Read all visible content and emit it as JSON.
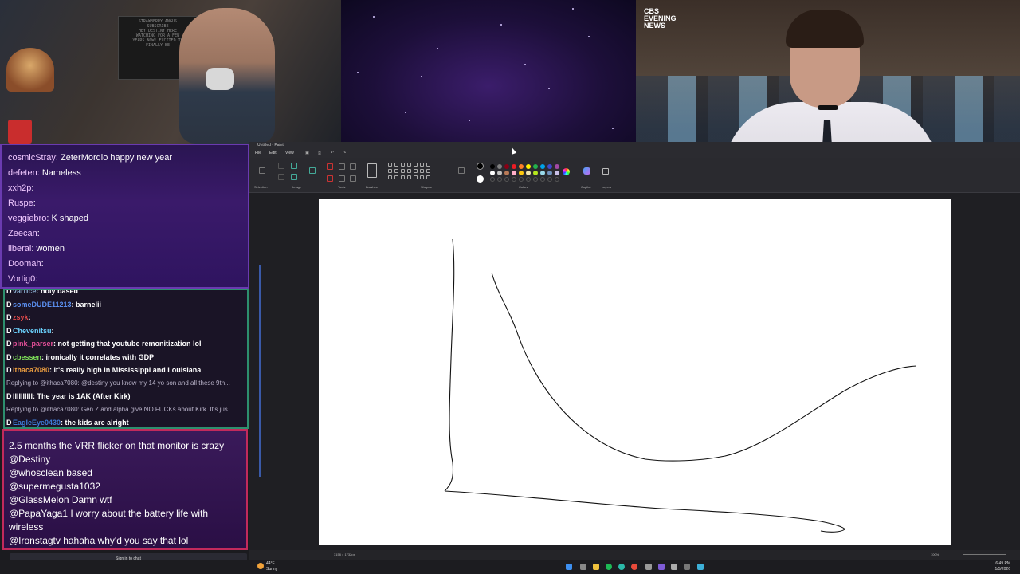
{
  "webcam": {
    "board_text": "STRAWBERRY ANGUS\nSUBSCRIBE\nHEY DESTINY HERE\nWATCHING FOR A FEW\nYEARS NOW! EXCITED TO\nFINALLY BE"
  },
  "news": {
    "logo": "CBS EVENING NEWS",
    "timestamp": "0:59 / 10:19"
  },
  "chat_top": [
    {
      "user": "cosmicStray",
      "text": "ZeterMordio happy new year"
    },
    {
      "user": "defeten",
      "text": "Nameless"
    },
    {
      "user": "xxh2p",
      "text": ""
    },
    {
      "user": "Ruspe",
      "text": ""
    },
    {
      "user": "veggiebro",
      "text": "K shaped"
    },
    {
      "user": "Zeecan",
      "text": ""
    },
    {
      "user": "liberal",
      "text": "women"
    },
    {
      "user": "Doomah",
      "text": ""
    },
    {
      "user": "Vortig0",
      "text": ""
    }
  ],
  "chat_middle": [
    {
      "user": "varrice",
      "text": "holy based",
      "reply": false
    },
    {
      "user": "someDUDE11213",
      "text": "barnelii",
      "reply": false
    },
    {
      "user": "zsyk",
      "text": "",
      "reply": false
    },
    {
      "user": "Chevenitsu",
      "text": "",
      "reply": false
    },
    {
      "user": "pink_parser",
      "text": "not getting that youtube remonitization lol",
      "reply": false
    },
    {
      "user": "cbessen",
      "text": "ironically it correlates with GDP",
      "reply": false
    },
    {
      "user": "ithaca7080",
      "text": "it's really high in Mississippi and Louisiana",
      "reply": false
    },
    {
      "user": "",
      "text": "Replying to @ithaca7080: @destiny you know my 14 yo son and all these 9th...",
      "reply": true
    },
    {
      "user": "IIIIIIIIll",
      "text": "The year is 1AK (After Kirk)",
      "reply": false
    },
    {
      "user": "",
      "text": "Replying to @ithaca7080: Gen Z and alpha give NO FUCKs about Kirk. It's jus...",
      "reply": true
    },
    {
      "user": "EagleEye0430",
      "text": "the kids are alright",
      "reply": false
    }
  ],
  "chat_bottom": [
    "2.5 months the VRR flicker on that monitor is crazy",
    "@Destiny",
    "@whosclean based",
    "@supermegusta1032",
    "@GlassMelon Damn wtf",
    "@PapaYaga1 I worry about the battery life with",
    "wireless",
    "@Ironstagtv hahaha why'd you say that lol"
  ],
  "sign_in_label": "Sign in to chat",
  "paint": {
    "title": "Untitled - Paint",
    "menu": [
      "File",
      "Edit",
      "View"
    ],
    "groups": [
      "Selection",
      "Image",
      "Tools",
      "Brushes",
      "Shapes",
      "Colors",
      "Copilot",
      "Layers"
    ],
    "status_size": "3158 × 1732px",
    "zoom": "100%",
    "colors": [
      "#000000",
      "#7f7f7f",
      "#880015",
      "#ed1c24",
      "#ff7f27",
      "#fff200",
      "#22b14c",
      "#00a2e8",
      "#3f48cc",
      "#a349a4",
      "#ffffff",
      "#c3c3c3",
      "#b97a57",
      "#ffaec9",
      "#ffc90e",
      "#efe4b0",
      "#b5e61d",
      "#99d9ea",
      "#7092be",
      "#c8bfe7"
    ]
  },
  "taskbar": {
    "weather_temp": "44°F",
    "weather_desc": "Sunny",
    "time": "6:49 PM",
    "date": "1/5/2026"
  }
}
